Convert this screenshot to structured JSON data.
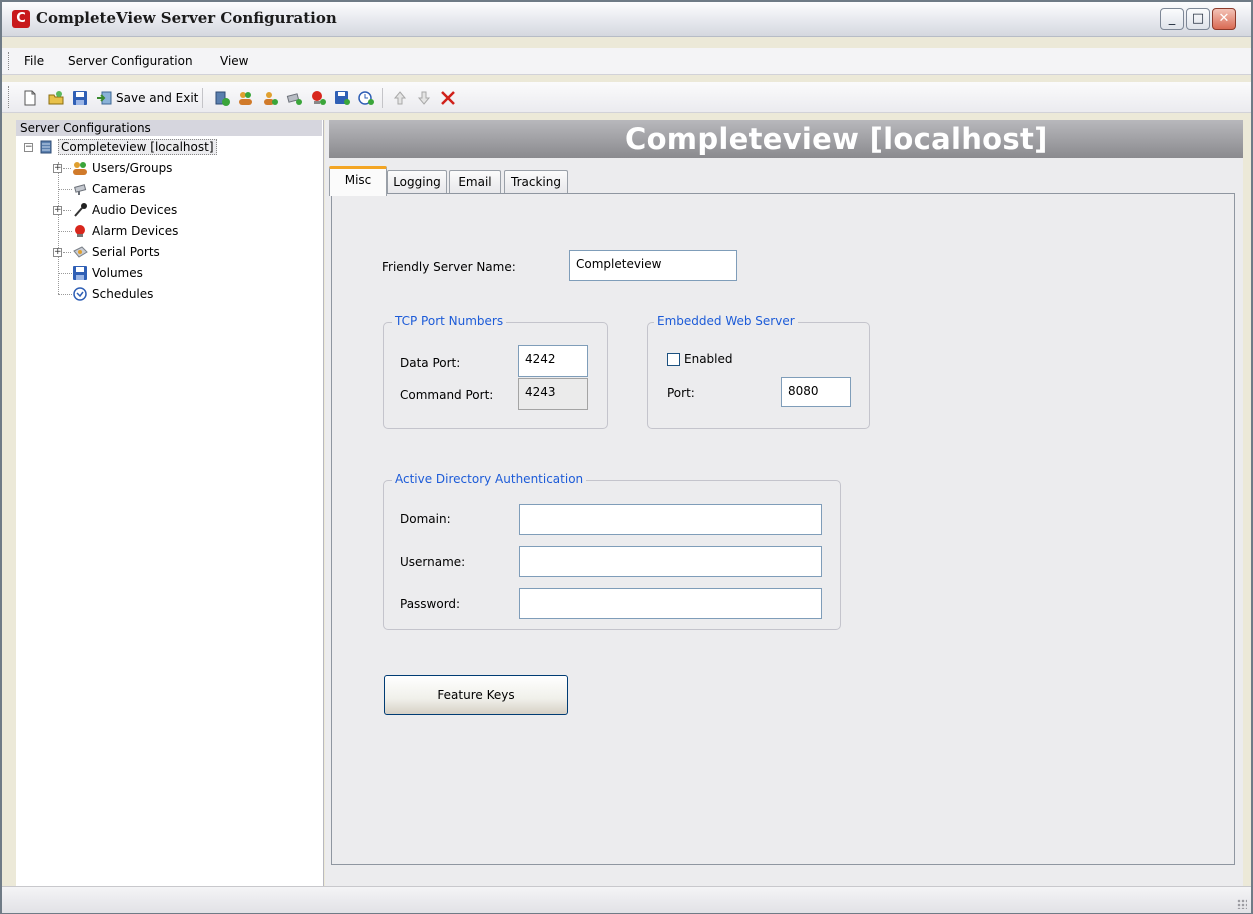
{
  "window": {
    "title": "CompleteView Server Configuration"
  },
  "menu": {
    "items": [
      "File",
      "Server Configuration",
      "View"
    ]
  },
  "toolbar": {
    "save_exit_label": "Save and Exit"
  },
  "tree": {
    "header": "Server Configurations",
    "root": "Completeview [localhost]",
    "items": [
      "Users/Groups",
      "Cameras",
      "Audio Devices",
      "Alarm Devices",
      "Serial Ports",
      "Volumes",
      "Schedules"
    ]
  },
  "banner": {
    "title": "Completeview [localhost]"
  },
  "tabs": [
    "Misc",
    "Logging",
    "Email",
    "Tracking"
  ],
  "misc": {
    "friendly_name_label": "Friendly Server Name:",
    "friendly_name_value": "Completeview",
    "tcp": {
      "title": "TCP Port Numbers",
      "data_port_label": "Data Port:",
      "data_port_value": "4242",
      "command_port_label": "Command Port:",
      "command_port_value": "4243"
    },
    "web": {
      "title": "Embedded Web Server",
      "enabled_label": "Enabled",
      "enabled": false,
      "port_label": "Port:",
      "port_value": "8080"
    },
    "ad": {
      "title": "Active Directory Authentication",
      "domain_label": "Domain:",
      "domain_value": "",
      "username_label": "Username:",
      "username_value": "",
      "password_label": "Password:",
      "password_value": ""
    },
    "feature_keys_label": "Feature Keys"
  }
}
